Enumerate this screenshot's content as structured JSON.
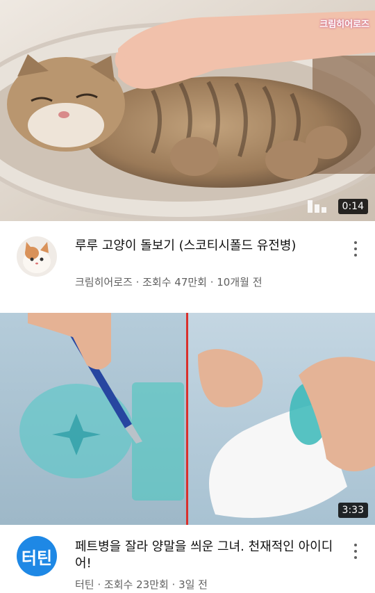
{
  "videos": [
    {
      "thumbnail_desc": "tabby cat being petted in bowl",
      "duration": "0:14",
      "watermark": "크림히어로즈",
      "title": "루루 고양이 돌보기 (스코티시폴드 유전병)",
      "channel_meta": "크림히어로즈 · 조회수 47만회 · 10개월 전",
      "avatar_icon": "cat-avatar"
    },
    {
      "thumbnail_desc": "cutting plastic bottle and putting sock on it",
      "duration": "3:33",
      "title": "페트병을 잘라 양말을 씌운 그녀. 천재적인 아이디어!",
      "channel_meta": "터틴 · 조회수 23만회 · 3일 전",
      "avatar_text": "터틴",
      "accent": "#1e88e5"
    }
  ],
  "colors": {
    "divider": "#d9302c",
    "meta": "#606060"
  },
  "icons": {
    "more": "more-vertical-icon"
  }
}
